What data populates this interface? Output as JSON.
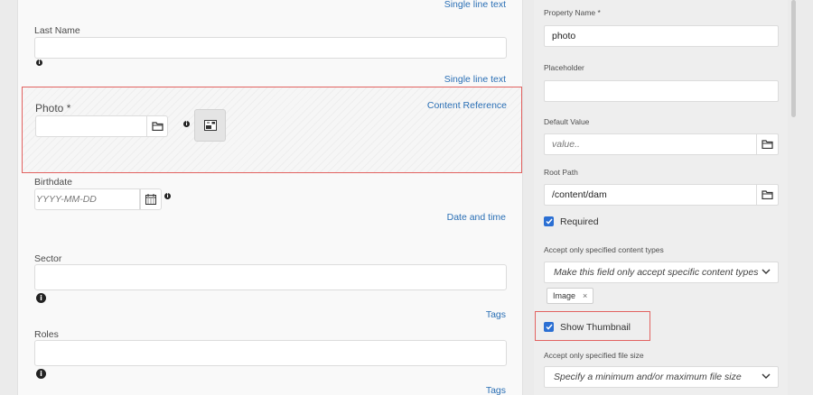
{
  "form": {
    "first_name_type": "Single line text",
    "last_name": {
      "label": "Last Name",
      "type": "Single line text",
      "value": ""
    },
    "photo": {
      "label": "Photo *",
      "type": "Content Reference",
      "value": ""
    },
    "birthdate": {
      "label": "Birthdate",
      "placeholder": "YYYY-MM-DD",
      "type": "Date and time"
    },
    "sector": {
      "label": "Sector",
      "type": "Tags"
    },
    "roles": {
      "label": "Roles",
      "type": "Tags"
    }
  },
  "properties": {
    "property_name": {
      "label": "Property Name *",
      "value": "photo"
    },
    "placeholder": {
      "label": "Placeholder",
      "value": ""
    },
    "default_value": {
      "label": "Default Value",
      "placeholder": "value.."
    },
    "root_path": {
      "label": "Root Path",
      "value": "/content/dam"
    },
    "required": {
      "label": "Required",
      "checked": true
    },
    "content_types": {
      "label": "Accept only specified content types",
      "placeholder": "Make this field only accept specific content types",
      "tags": [
        "Image"
      ],
      "tag_remove": "×"
    },
    "show_thumbnail": {
      "label": "Show Thumbnail",
      "checked": true
    },
    "file_size": {
      "label": "Accept only specified file size",
      "placeholder": "Specify a minimum and/or maximum file size"
    }
  },
  "colors": {
    "accent_blue": "#2b6fd3",
    "link_blue": "#2a6fb5",
    "highlight_red": "#e26260"
  }
}
